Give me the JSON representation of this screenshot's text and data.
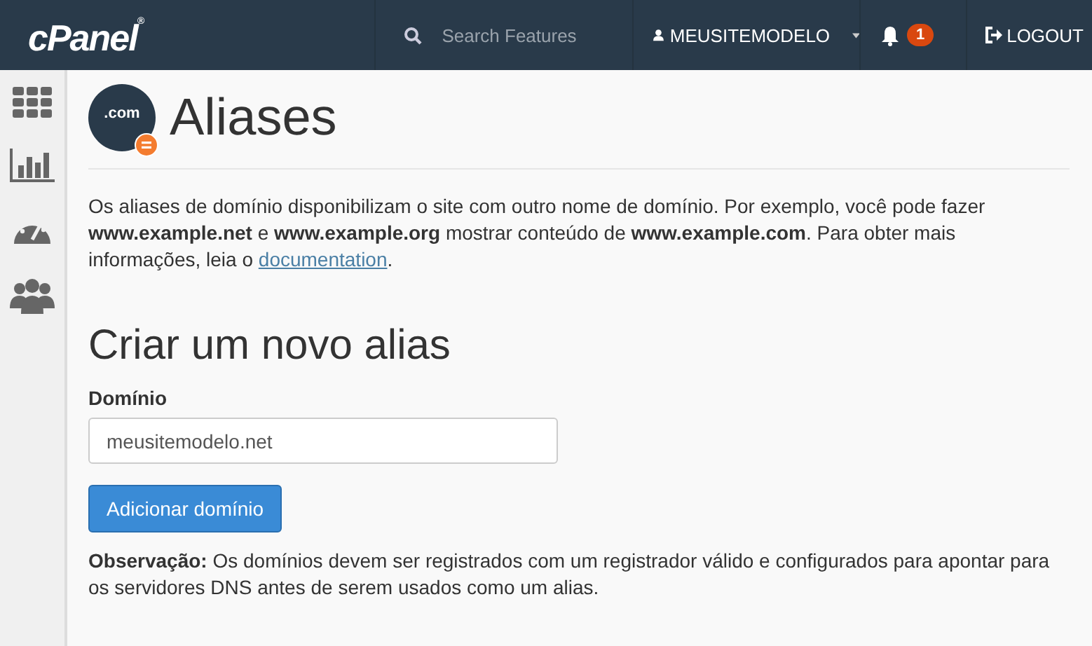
{
  "header": {
    "logo": "cPanel",
    "logo_mark": "®",
    "search": {
      "placeholder": "Search Features"
    },
    "user": "MEUSITEMODELO",
    "notifications": "1",
    "logout": "LOGOUT"
  },
  "sidebar": {
    "items": [
      {
        "kind": "grid"
      },
      {
        "kind": "chart"
      },
      {
        "kind": "gauge"
      },
      {
        "kind": "users"
      }
    ]
  },
  "page": {
    "icon_text": ".com",
    "title": "Aliases",
    "description": {
      "before": "Os aliases de domínio disponibilizam o site com outro nome de domínio. Por exemplo, você pode fazer **www.example.net** e **www.example.org** mostrar conteúdo de **www.example.com**. Para obter mais informações, leia o ",
      "link": "documentation",
      "after": "."
    }
  },
  "form": {
    "heading": "Criar um novo alias",
    "label": "Domínio",
    "value": "meusitemodelo.net",
    "button": "Adicionar domínio",
    "note": "**Observação:** Os domínios devem ser registrados com um registrador válido e configurados para apontar para os servidores DNS antes de serem usados como um alias."
  }
}
